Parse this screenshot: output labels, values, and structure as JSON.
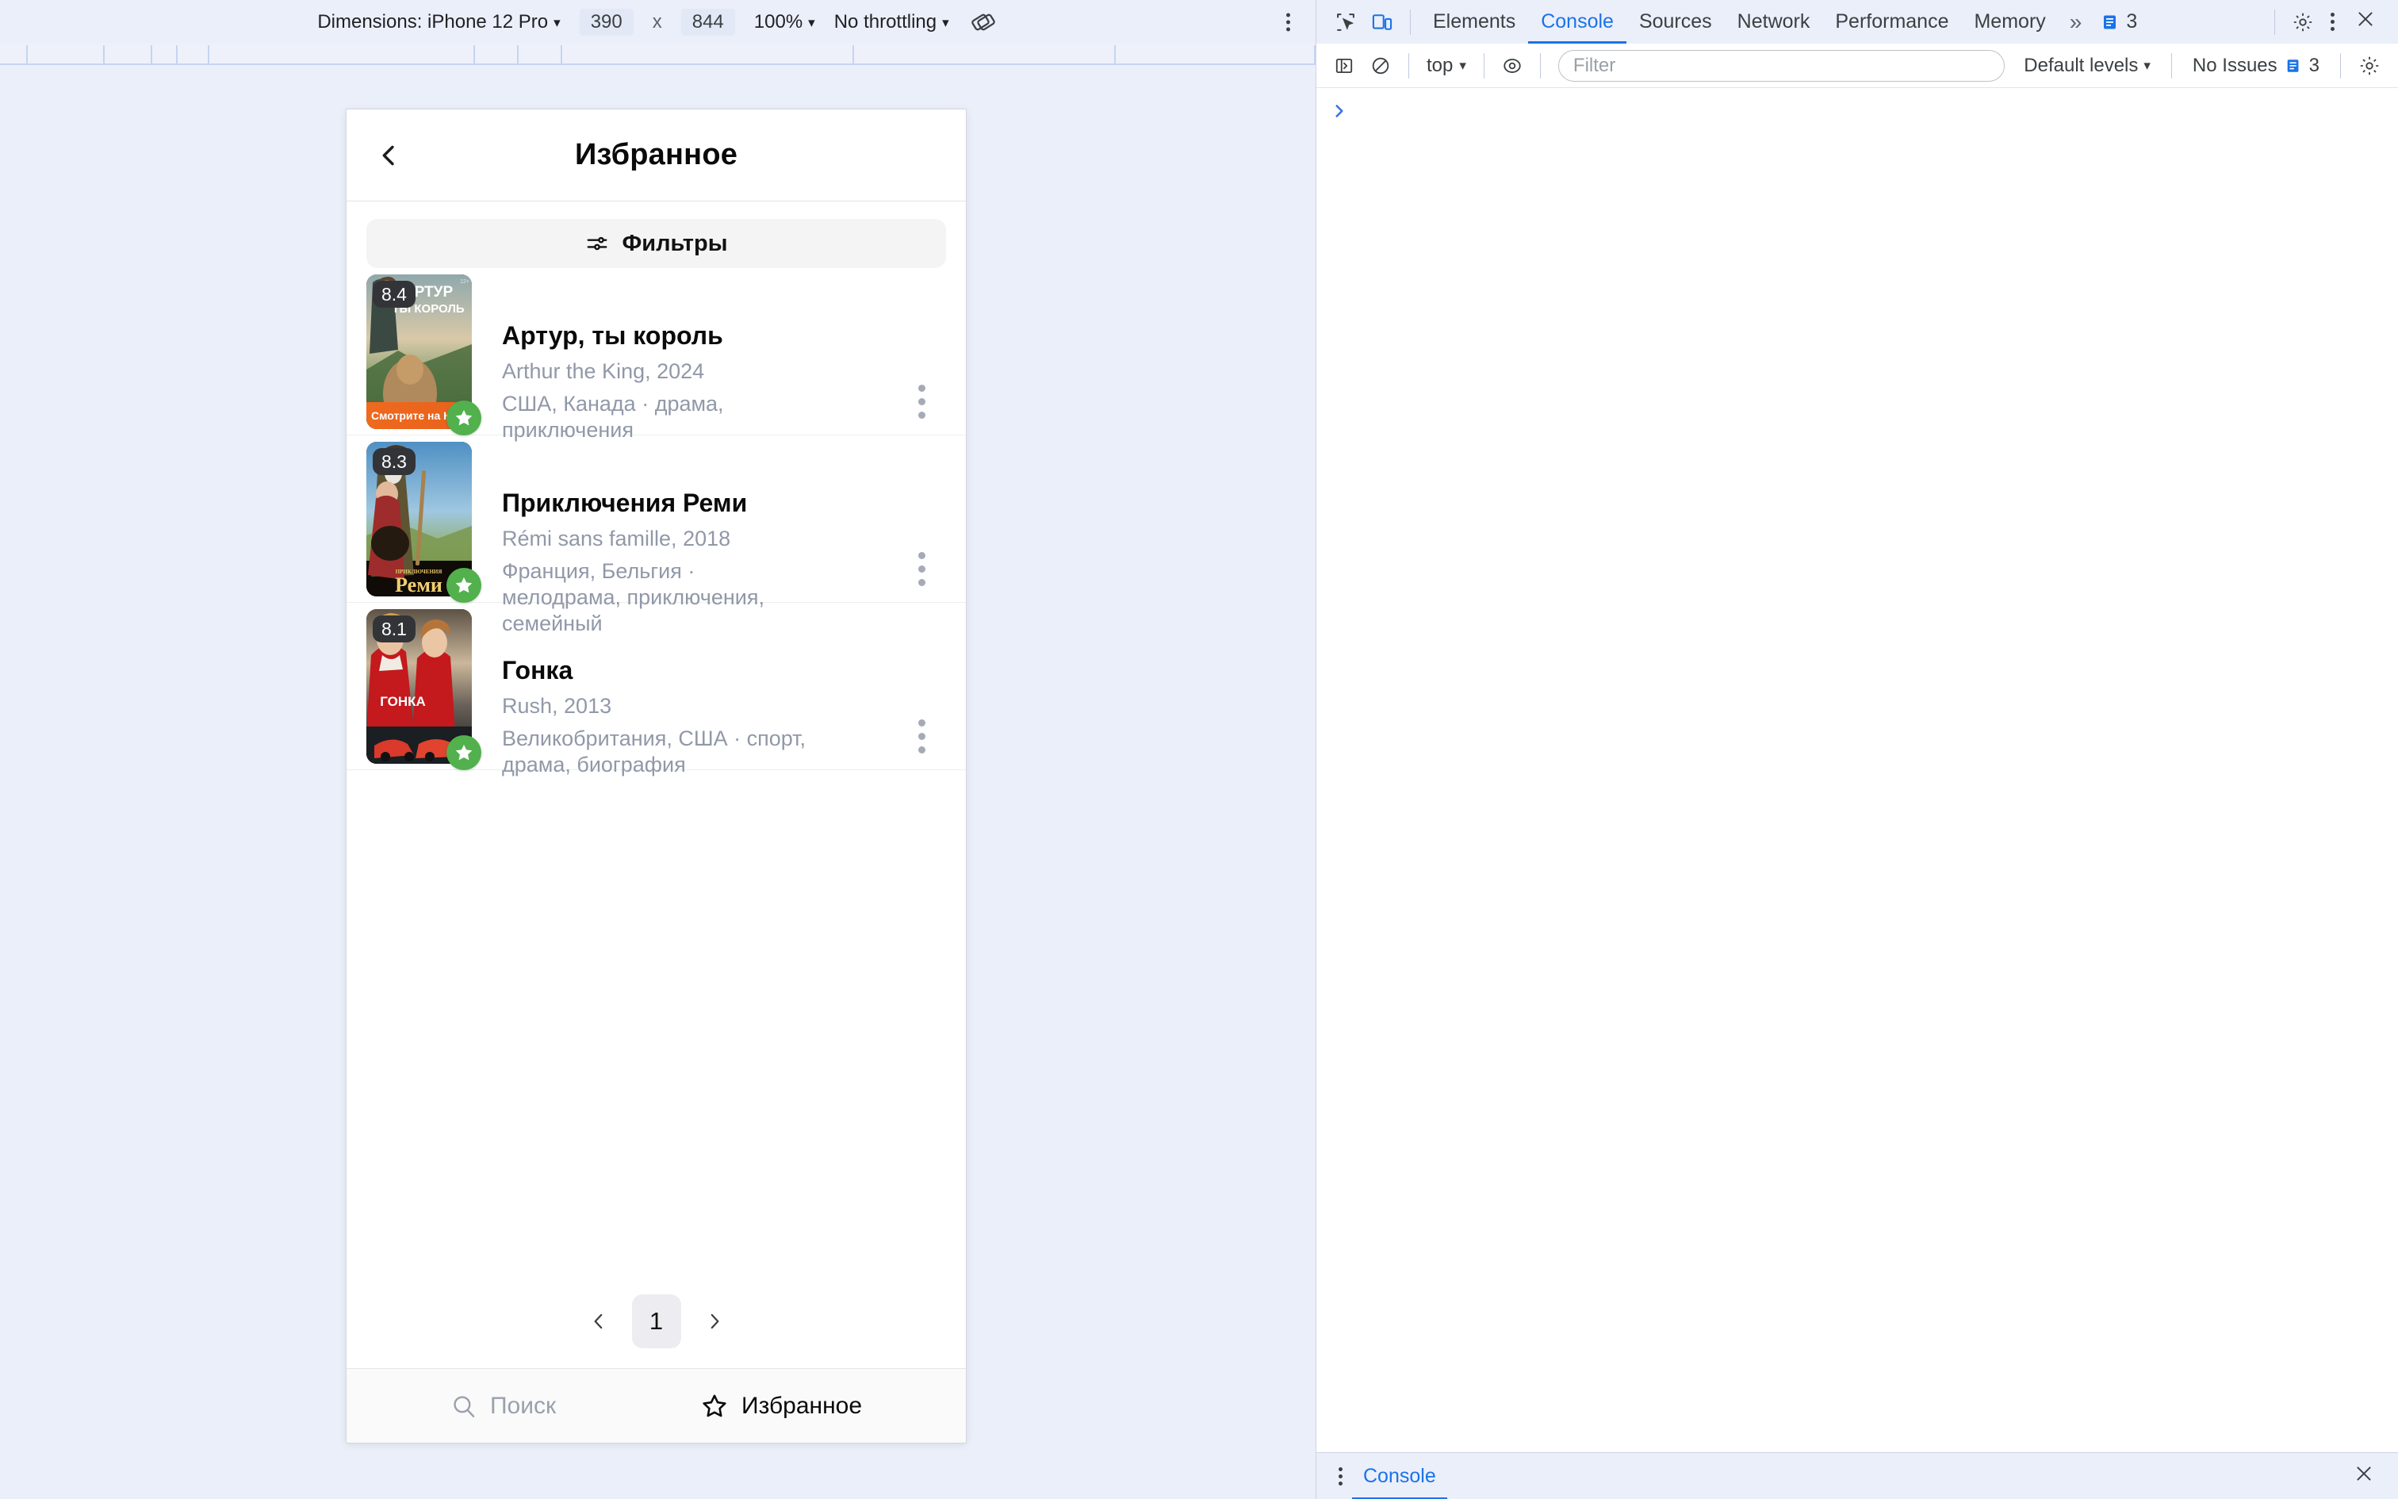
{
  "device_toolbar": {
    "dimensions_label": "Dimensions: iPhone 12 Pro",
    "width_value": "390",
    "times": "x",
    "height_value": "844",
    "zoom_value": "100%",
    "throttling_value": "No throttling",
    "caret": "▾",
    "rotate_icon": "rotate-icon",
    "more_icon": "kebab-menu-icon"
  },
  "app": {
    "header": {
      "back_icon": "chevron-left-icon",
      "title": "Избранное"
    },
    "filters": {
      "icon": "sliders-icon",
      "label": "Фильтры"
    },
    "movies": [
      {
        "rating": "8.4",
        "title": "Артур, ты король",
        "original": "Arthur the King, 2024",
        "meta": "США, Канада · драма, приключения",
        "poster_banner": "Смотрите на Кинопоиск",
        "age_badge": "12+",
        "favorite_icon": "star-filled-icon",
        "menu_icon": "kebab-menu-icon",
        "poster_name": "poster-arthur-the-king"
      },
      {
        "rating": "8.3",
        "title": "Приключения Реми",
        "original": "Rémi sans famille, 2018",
        "meta": "Франция, Бельгия · мелодрама, приключения, семейный",
        "poster_banner": "",
        "age_badge": "",
        "favorite_icon": "star-filled-icon",
        "menu_icon": "kebab-menu-icon",
        "poster_name": "poster-remi-sans-famille"
      },
      {
        "rating": "8.1",
        "title": "Гонка",
        "original": "Rush, 2013",
        "meta": "Великобритания, США · спорт, драма, биография",
        "poster_banner": "",
        "age_badge": "",
        "favorite_icon": "star-filled-icon",
        "menu_icon": "kebab-menu-icon",
        "poster_name": "poster-rush"
      }
    ],
    "pagination": {
      "prev_icon": "chevron-left-icon",
      "current_page": "1",
      "next_icon": "chevron-right-icon"
    },
    "bottom_nav": [
      {
        "icon": "search-icon",
        "label": "Поиск",
        "active": false
      },
      {
        "icon": "star-outline-icon",
        "label": "Избранное",
        "active": true
      }
    ]
  },
  "devtools": {
    "inspect_icon": "inspect-element-icon",
    "device_toggle_icon": "device-toolbar-icon",
    "tabs": [
      {
        "label": "Elements",
        "selected": false
      },
      {
        "label": "Console",
        "selected": true
      },
      {
        "label": "Sources",
        "selected": false
      },
      {
        "label": "Network",
        "selected": false
      },
      {
        "label": "Performance",
        "selected": false
      },
      {
        "label": "Memory",
        "selected": false
      }
    ],
    "overflow_icon": "double-chevron-right-icon",
    "issues_count": "3",
    "issues_icon": "issues-icon",
    "settings_icon": "gear-icon",
    "kebab_icon": "kebab-menu-icon",
    "close_icon": "close-icon",
    "console_toolbar": {
      "sidebar_icon": "console-sidebar-icon",
      "clear_icon": "clear-console-icon",
      "context_value": "top",
      "caret": "▾",
      "eye_icon": "live-expression-icon",
      "filter_placeholder": "Filter",
      "filter_value": "",
      "levels_value": "Default levels",
      "issues_status": "No Issues",
      "issues_status_count": "3",
      "settings_icon": "gear-icon"
    },
    "prompt_icon": "console-prompt-chevron-icon",
    "statusbar": {
      "kebab_icon": "kebab-menu-icon",
      "tab_label": "Console",
      "close_icon": "close-icon"
    }
  },
  "colors": {
    "accent_blue": "#1a73e8",
    "devtools_bg": "#ebeffa",
    "favorite_green": "#52b04d",
    "kinopoisk_orange": "#ee6a1e",
    "muted_text": "#9198a8"
  }
}
